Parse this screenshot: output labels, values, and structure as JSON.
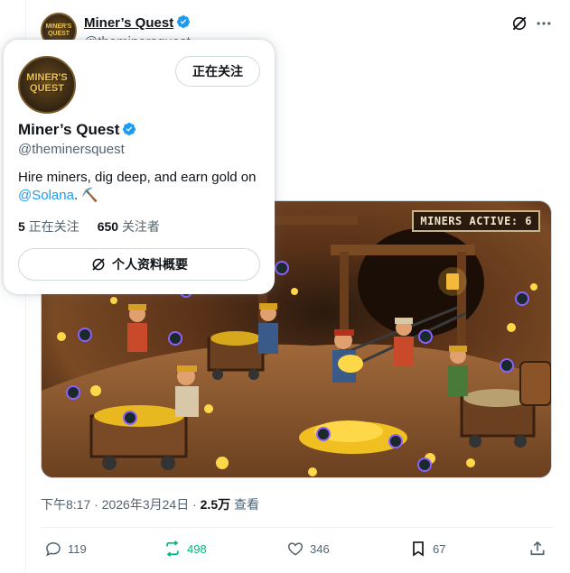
{
  "author": {
    "name": "Miner’s Quest",
    "handle": "@theminersquest",
    "avatar_text": "MINER'S QUEST"
  },
  "media": {
    "badge": "MINERS ACTIVE: 6"
  },
  "meta": {
    "time": "下午8:17 · 2026年3月24日 · ",
    "views_count": "2.5万",
    "views_label": " 查看"
  },
  "actions": {
    "reply_count": "119",
    "retweet_count": "498",
    "like_count": "346",
    "bookmark_count": "67"
  },
  "hover_card": {
    "follow_label": "正在关注",
    "name": "Miner’s Quest",
    "handle": "@theminersquest",
    "bio_text": "Hire miners, dig deep, and earn gold on ",
    "bio_mention": "@Solana",
    "bio_suffix": ". ⛏️",
    "following_count": "5",
    "following_label": "正在关注",
    "followers_count": "650",
    "followers_label": "关注者",
    "profile_button_label": "个人资料概要"
  },
  "colors": {
    "accent": "#1d9bf0",
    "retweet": "#00ba7c",
    "muted": "#536471"
  }
}
